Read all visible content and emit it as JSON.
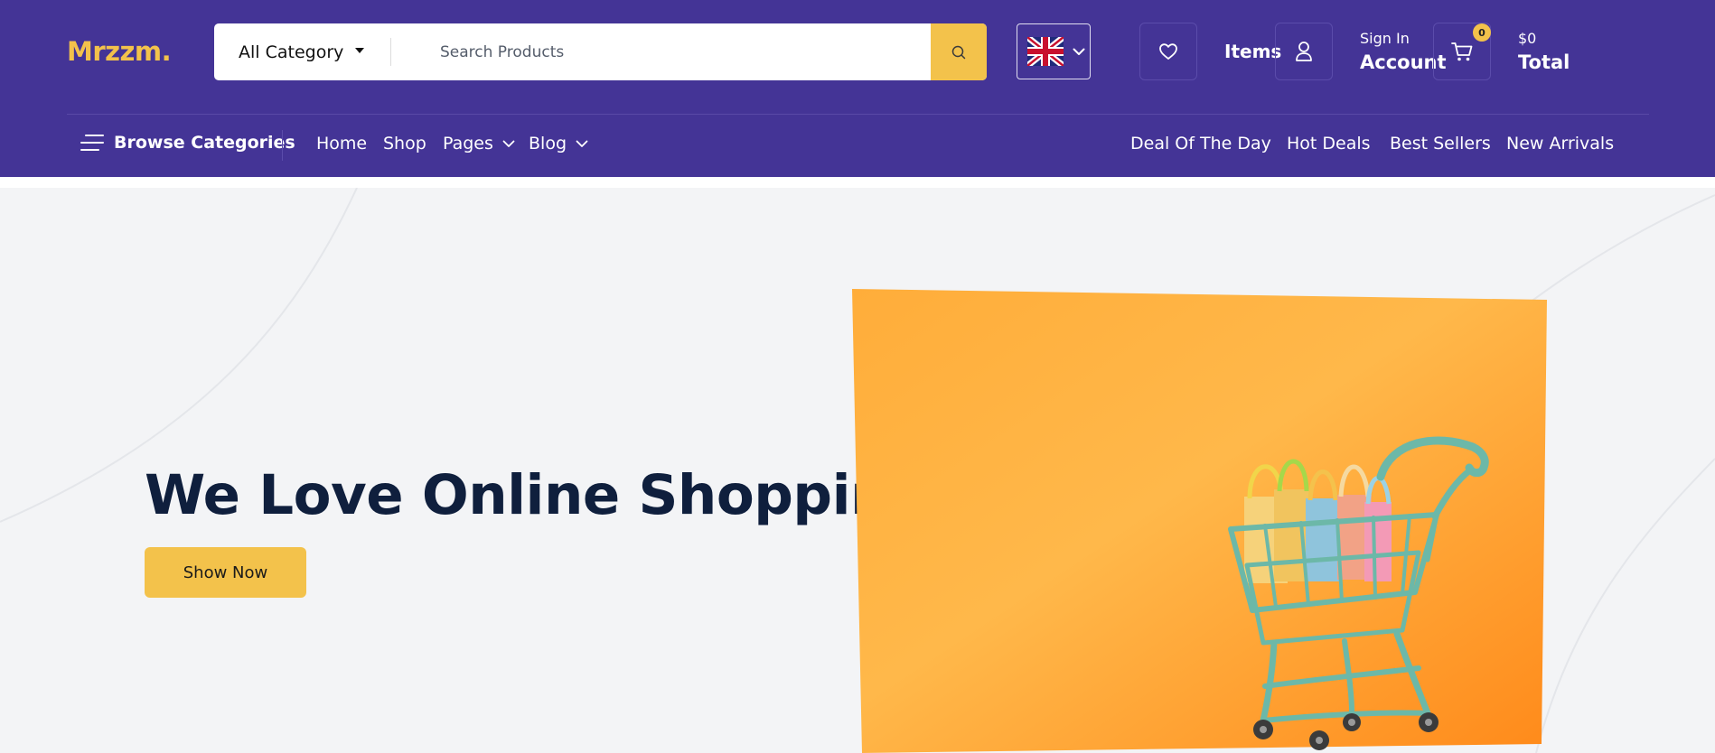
{
  "header": {
    "logo": "Mrzzm.",
    "search": {
      "category_selected": "All Category",
      "placeholder": "Search Products",
      "value": ""
    },
    "language": {
      "icon": "uk-flag-icon"
    },
    "items_label": "Items",
    "account": {
      "small": "Sign In",
      "big": "Account"
    },
    "cart": {
      "count": "0",
      "amount": "$0",
      "label": "Total"
    }
  },
  "nav": {
    "browse_label": "Browse Categories",
    "links": [
      "Home",
      "Shop",
      "Pages",
      "Blog"
    ],
    "right_links": [
      "Deal Of The Day",
      "Hot Deals",
      "Best Sellers",
      "New Arrivals"
    ]
  },
  "hero": {
    "title": "We Love Online Shopping",
    "button": "Show Now"
  },
  "colors": {
    "header_bg": "#443496",
    "accent": "#f3c24b",
    "hero_bg": "#f3f4f6",
    "heading": "#0f1f3d",
    "banner_orange": "#ff9a2a"
  }
}
